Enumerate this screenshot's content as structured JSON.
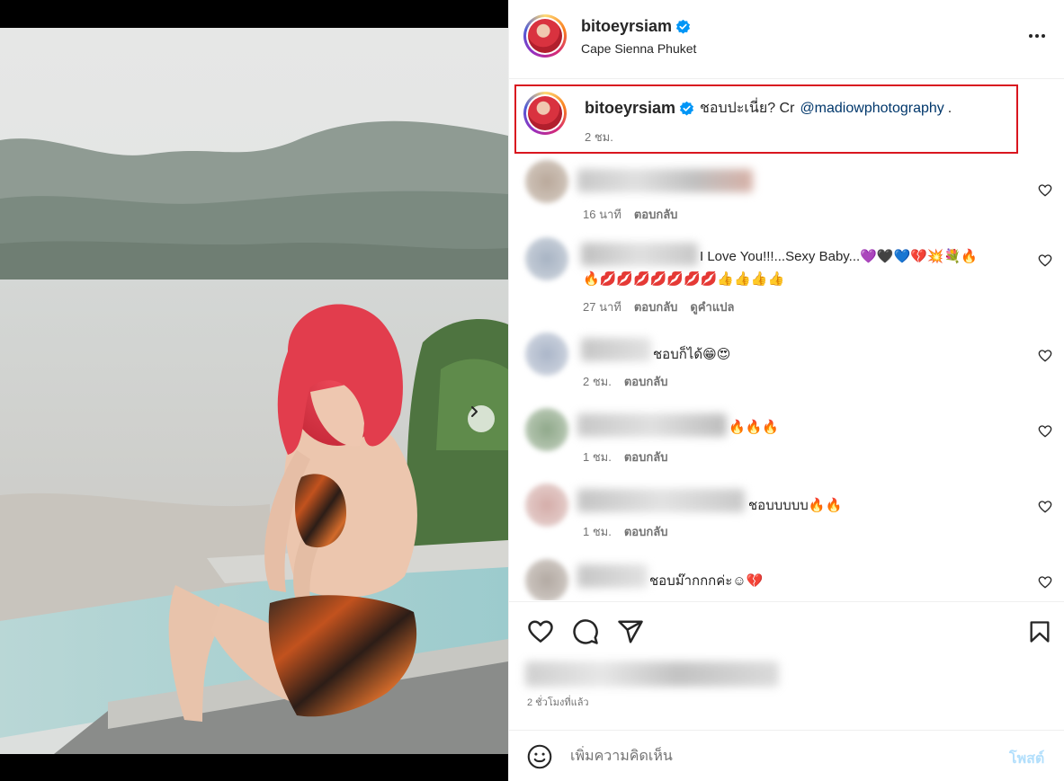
{
  "post": {
    "username": "bitoeyrsiam",
    "location": "Cape Sienna Phuket",
    "more_icon": "more-horizontal-icon",
    "verified_icon": "verified-badge-icon"
  },
  "caption": {
    "username": "bitoeyrsiam",
    "text": "ชอบปะเนี่ย? Cr",
    "mention": "@madiowphotography",
    "trailing": ".",
    "time": "2 ชม."
  },
  "comments": [
    {
      "text": "",
      "time": "16 นาที",
      "reply": "ตอบกลับ"
    },
    {
      "text": "I Love You!!!...Sexy Baby...💜🖤💙💔💥💐🔥",
      "text2": "🔥💋💋💋💋💋💋💋👍👍👍👍",
      "time": "27 นาที",
      "reply": "ตอบกลับ",
      "translate": "ดูคำแปล"
    },
    {
      "text": "ชอบก็ได้😁😍",
      "time": "2 ชม.",
      "reply": "ตอบกลับ"
    },
    {
      "text": "🔥🔥🔥",
      "time": "1 ชม.",
      "reply": "ตอบกลับ"
    },
    {
      "text": "ชอบบบบบ🔥🔥",
      "time": "1 ชม.",
      "reply": "ตอบกลับ"
    },
    {
      "text": "ชอบม๊ากกกค่ะ☺💔",
      "time": "",
      "reply": ""
    }
  ],
  "actions": {
    "like_icon": "heart-icon",
    "comment_icon": "comment-icon",
    "share_icon": "send-icon",
    "save_icon": "bookmark-icon"
  },
  "post_time": "2 ชั่วโมงที่แล้ว",
  "add_comment": {
    "placeholder": "เพิ่มความคิดเห็น",
    "post_label": "โพสต์",
    "emoji_icon": "emoji-smile-icon"
  },
  "media": {
    "next_icon": "chevron-right-icon",
    "slide_count": 3,
    "active_slide": 1
  }
}
